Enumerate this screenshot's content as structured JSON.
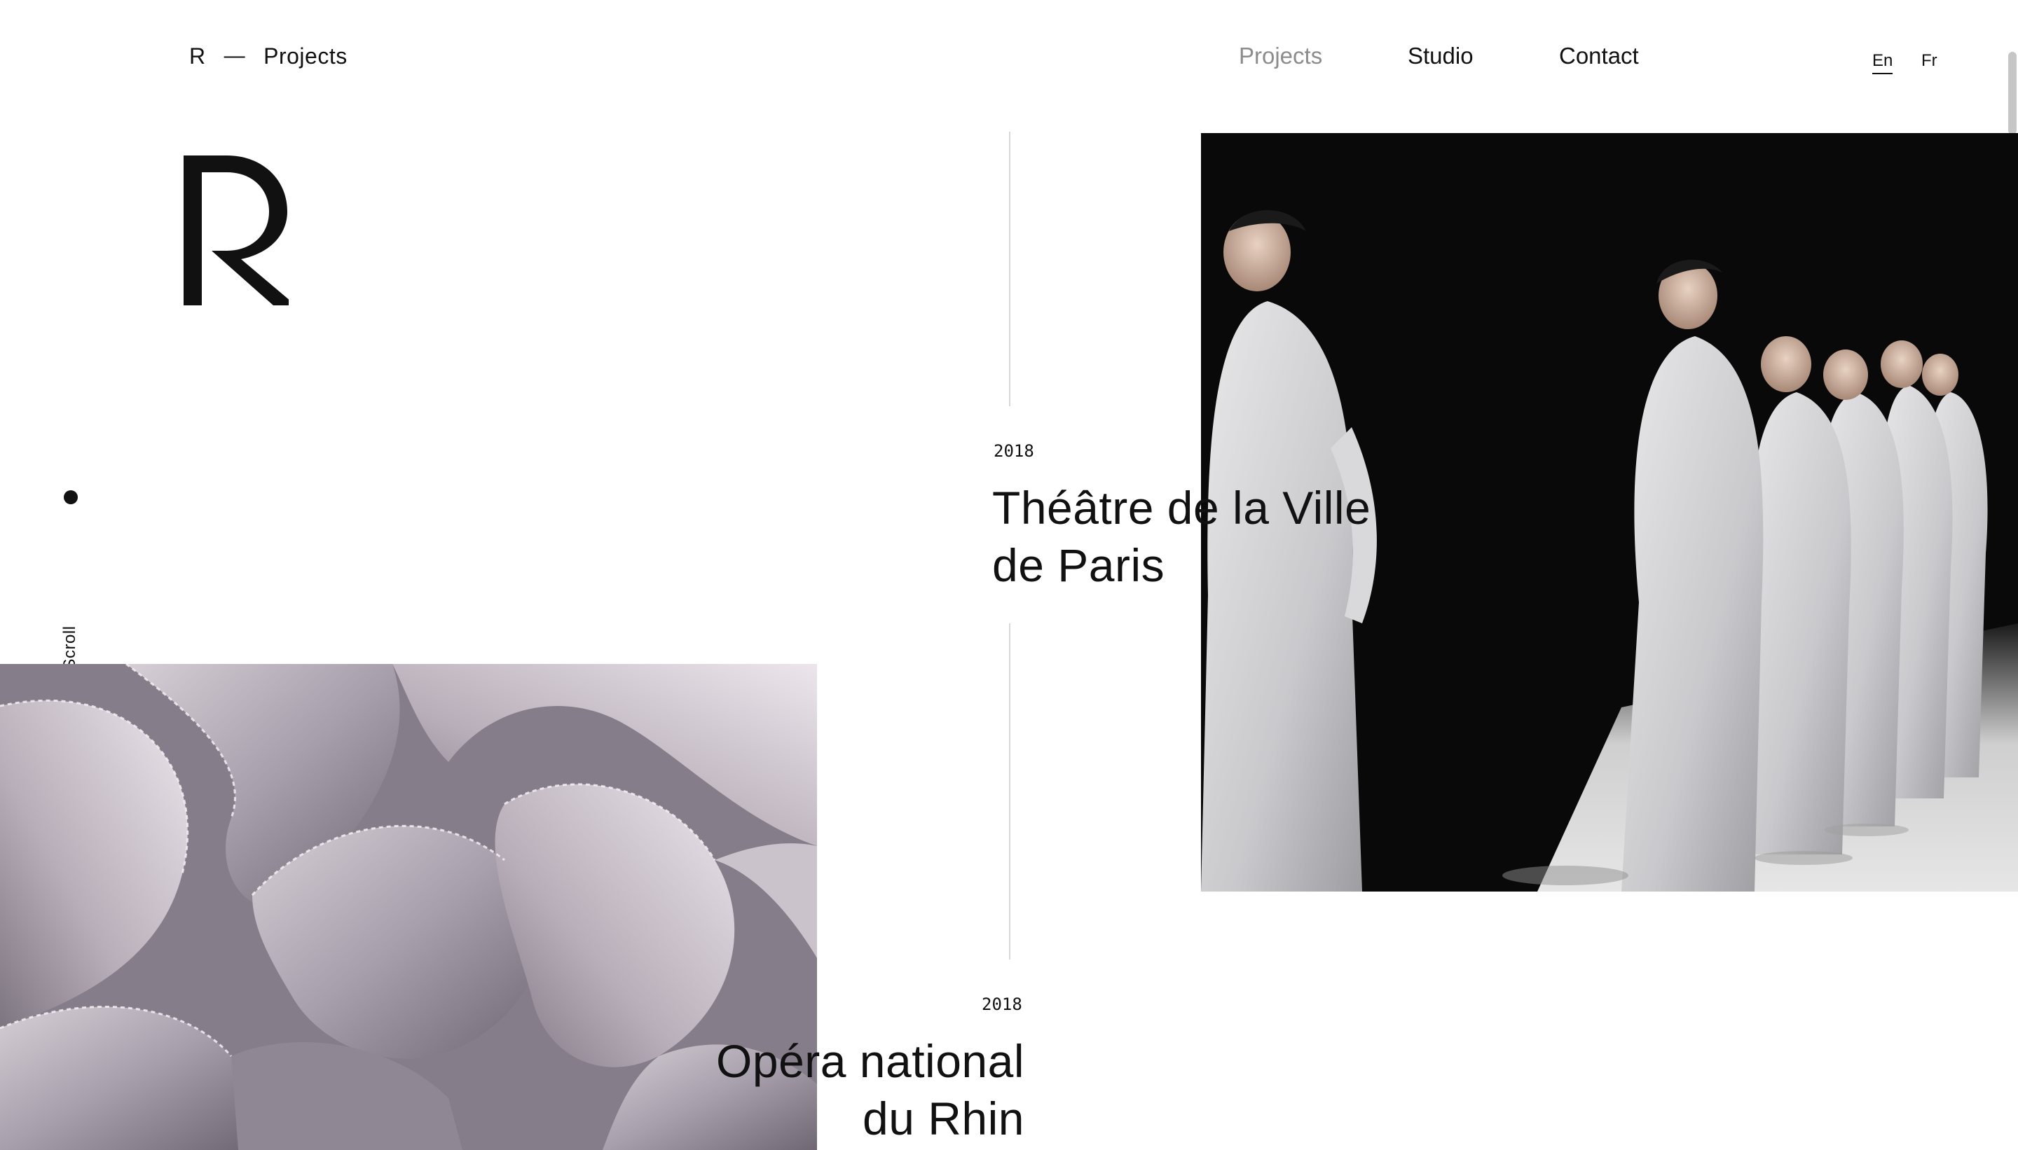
{
  "header": {
    "brand_letter": "R",
    "separator": "—",
    "section": "Projects"
  },
  "nav": {
    "items": [
      {
        "label": "Projects",
        "active": true
      },
      {
        "label": "Studio",
        "active": false
      },
      {
        "label": "Contact",
        "active": false
      }
    ]
  },
  "languages": {
    "items": [
      {
        "label": "En",
        "active": true
      },
      {
        "label": "Fr",
        "active": false
      }
    ]
  },
  "sidebar": {
    "scroll_label": "Scroll"
  },
  "projects": [
    {
      "year": "2018",
      "title_line1": "Théâtre de la Ville",
      "title_line2": "de Paris",
      "image": "dancers-in-white-dresses"
    },
    {
      "year": "2018",
      "title_line1": "Opéra national",
      "title_line2": "du Rhin",
      "image": "lavender-fabric-folds"
    }
  ],
  "colors": {
    "text": "#111111",
    "nav_active": "#8c8c8c",
    "divider": "#d8d8d8",
    "background": "#ffffff"
  }
}
